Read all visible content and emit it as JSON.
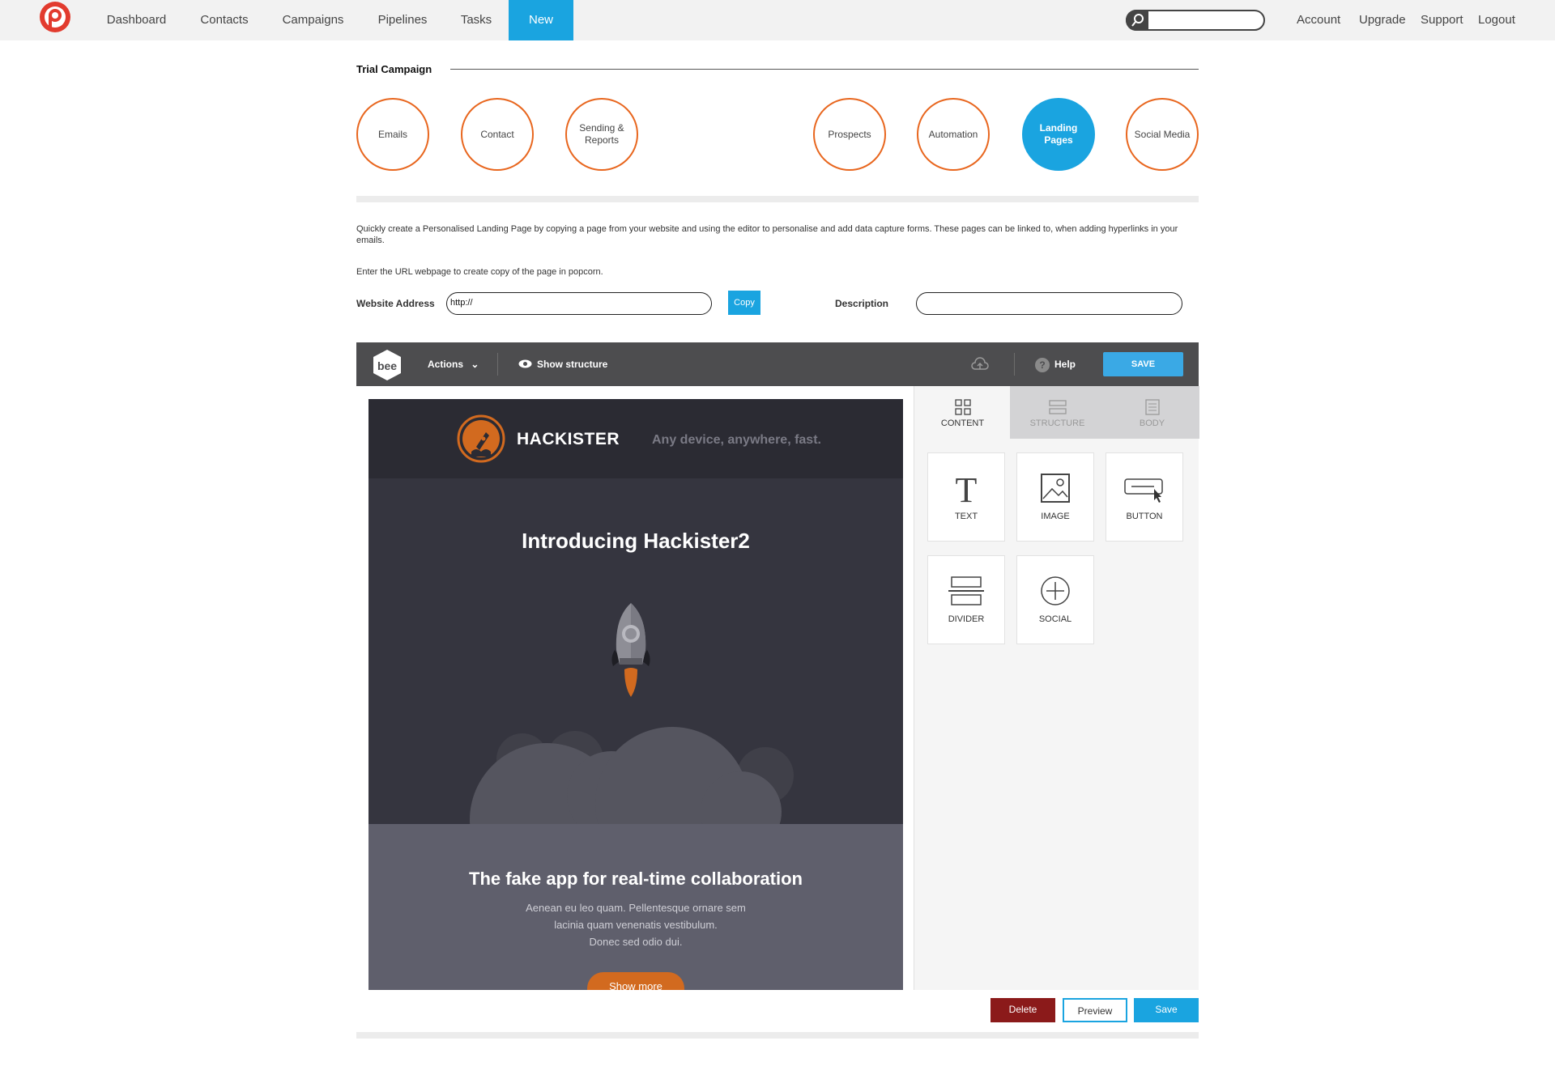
{
  "nav": {
    "items": [
      "Dashboard",
      "Contacts",
      "Campaigns",
      "Pipelines",
      "Tasks",
      "New"
    ],
    "active": "New",
    "right_links": [
      "Account",
      "Upgrade",
      "Support",
      "Logout"
    ],
    "search_placeholder": ""
  },
  "campaign": {
    "title": "Trial Campaign",
    "steps": [
      "Emails",
      "Contact",
      "Sending & Reports",
      "Prospects",
      "Automation",
      "Landing Pages",
      "Social Media"
    ],
    "active_step": "Landing Pages"
  },
  "form": {
    "intro": "Quickly create a Personalised Landing Page by copying a page from your website and using the editor to personalise and add data capture forms. These pages can be linked to, when adding hyperlinks in your emails.",
    "instruction": "Enter the URL webpage to create copy of the page in popcorn.",
    "website_label": "Website Address",
    "website_value": "http://",
    "copy_label": "Copy",
    "description_label": "Description",
    "description_value": ""
  },
  "editor": {
    "logo_text": "bee",
    "actions_label": "Actions",
    "show_structure_label": "Show structure",
    "help_label": "Help",
    "save_label": "SAVE",
    "tabs": [
      "CONTENT",
      "STRUCTURE",
      "BODY"
    ],
    "active_tab": "CONTENT",
    "tiles": [
      "TEXT",
      "IMAGE",
      "BUTTON",
      "DIVIDER",
      "SOCIAL"
    ]
  },
  "email": {
    "brand": "HACKISTER",
    "tagline": "Any device, anywhere, fast.",
    "hero_title": "Introducing Hackister2",
    "feature_title": "The fake app for real-time collaboration",
    "feature_body": [
      "Aenean eu leo quam. Pellentesque ornare sem",
      "lacinia quam venenatis vestibulum.",
      "Donec sed odio dui."
    ],
    "button_label": "Show more"
  },
  "actions": {
    "delete_label": "Delete",
    "preview_label": "Preview",
    "save_label": "Save"
  },
  "colors": {
    "accent": "#1aa4e0",
    "orange": "#e8661e",
    "delete": "#8b1a1a"
  }
}
